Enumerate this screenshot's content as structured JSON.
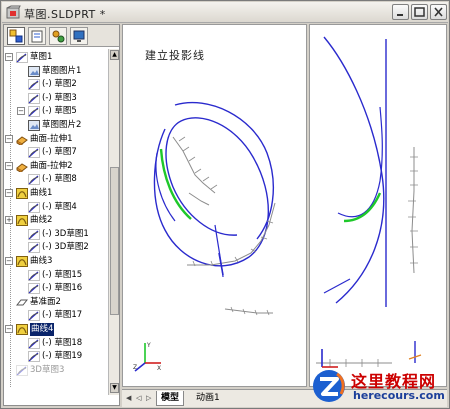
{
  "window": {
    "title": "草图.SLDPRT *"
  },
  "panel_tabs": [
    "feature-manager",
    "property-manager",
    "configuration-manager",
    "display-manager"
  ],
  "tree": [
    {
      "label": "草图1",
      "icon": "sketch",
      "expanded": true
    },
    {
      "label": "草图图片1",
      "icon": "sketch-picture"
    },
    {
      "label": "(-) 草图2",
      "icon": "sketch"
    },
    {
      "label": "(-) 草图3",
      "icon": "sketch"
    },
    {
      "label": "(-) 草图5",
      "icon": "sketch",
      "expanded": true
    },
    {
      "label": "草图图片2",
      "icon": "sketch-picture"
    },
    {
      "label": "曲面-拉伸1",
      "icon": "surface-extrude",
      "expanded": true
    },
    {
      "label": "(-) 草图7",
      "icon": "sketch"
    },
    {
      "label": "曲面-拉伸2",
      "icon": "surface-extrude",
      "expanded": true
    },
    {
      "label": "(-) 草图8",
      "icon": "sketch"
    },
    {
      "label": "曲线1",
      "icon": "curve",
      "expanded": true
    },
    {
      "label": "(-) 草图4",
      "icon": "sketch"
    },
    {
      "label": "曲线2",
      "icon": "curve",
      "collapsed": true
    },
    {
      "label": "(-) 3D草图1",
      "icon": "sketch"
    },
    {
      "label": "(-) 3D草图2",
      "icon": "sketch"
    },
    {
      "label": "曲线3",
      "icon": "curve",
      "expanded": true
    },
    {
      "label": "(-) 草图15",
      "icon": "sketch"
    },
    {
      "label": "(-) 草图16",
      "icon": "sketch"
    },
    {
      "label": "基准面2",
      "icon": "plane"
    },
    {
      "label": "(-) 草图17",
      "icon": "sketch"
    },
    {
      "label": "曲线4",
      "icon": "curve",
      "expanded": true,
      "selected": true
    },
    {
      "label": "(-) 草图18",
      "icon": "sketch"
    },
    {
      "label": "(-) 草图19",
      "icon": "sketch"
    },
    {
      "label": "3D草图3",
      "icon": "sketch",
      "greyed": true
    }
  ],
  "canvas": {
    "label": "建立投影线"
  },
  "bottom_tabs": [
    {
      "label": "模型",
      "active": true
    },
    {
      "label": "动画1",
      "active": false
    }
  ],
  "watermark": {
    "title": "这里教程网",
    "url": "herecours.com"
  },
  "colors": {
    "curve": "#2a2acd",
    "highlight": "#1ec82a",
    "construction": "#8c8c8c",
    "selected": "#0a246a"
  }
}
